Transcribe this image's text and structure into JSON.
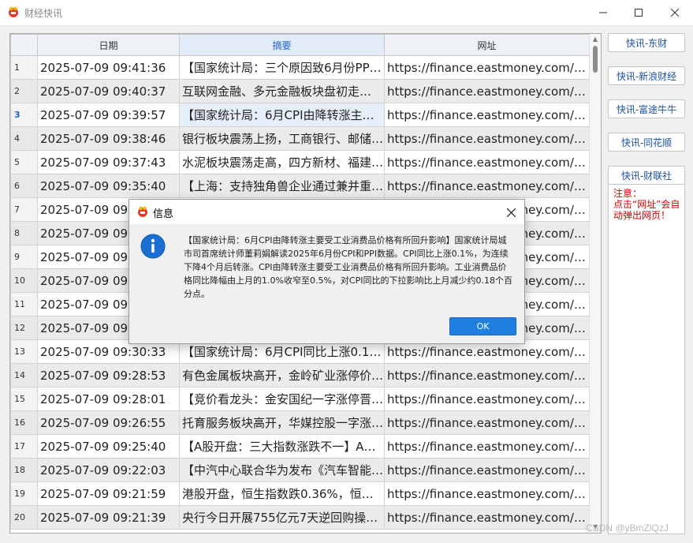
{
  "window": {
    "title": "财经快讯"
  },
  "grid": {
    "columns": [
      "日期",
      "摘要",
      "网址"
    ],
    "selected_row": 3,
    "rows": [
      {
        "n": "1",
        "date": "2025-07-09 09:41:36",
        "summary": "【国家统计局：三个原因致6月份PPI…",
        "url": "https://finance.eastmoney.com/a…"
      },
      {
        "n": "2",
        "date": "2025-07-09 09:40:37",
        "summary": "互联网金融、多元金融板块盘初走…",
        "url": "https://finance.eastmoney.com/a…"
      },
      {
        "n": "3",
        "date": "2025-07-09 09:39:57",
        "summary": "【国家统计局：6月CPI由降转涨主…",
        "url": "https://finance.eastmoney.com/a…"
      },
      {
        "n": "4",
        "date": "2025-07-09 09:38:46",
        "summary": "银行板块震荡上扬，工商银行、邮储…",
        "url": "https://finance.eastmoney.com/a…"
      },
      {
        "n": "5",
        "date": "2025-07-09 09:37:43",
        "summary": "水泥板块震荡走高，四方新材、福建…",
        "url": "https://finance.eastmoney.com/a…"
      },
      {
        "n": "6",
        "date": "2025-07-09 09:35:40",
        "summary": "【上海：支持独角兽企业通过兼并重…",
        "url": "https://finance.eastmoney.com/a…"
      },
      {
        "n": "7",
        "date": "2025-07-09 09:3",
        "summary": "",
        "url": "https://finance.eastmoney.com/a…"
      },
      {
        "n": "8",
        "date": "2025-07-09 09:3",
        "summary": "",
        "url": "https://finance.eastmoney.com/a…"
      },
      {
        "n": "9",
        "date": "2025-07-09 09:3",
        "summary": "",
        "url": "https://finance.eastmoney.com/a…"
      },
      {
        "n": "10",
        "date": "2025-07-09 09:3",
        "summary": "",
        "url": "https://finance.eastmoney.com/a…"
      },
      {
        "n": "11",
        "date": "2025-07-09 09:3",
        "summary": "",
        "url": "https://finance.eastmoney.com/a…"
      },
      {
        "n": "12",
        "date": "2025-07-09 09:3",
        "summary": "",
        "url": "https://finance.eastmoney.com/a…"
      },
      {
        "n": "13",
        "date": "2025-07-09 09:30:33",
        "summary": "【国家统计局：6月CPI同比上涨0.1…",
        "url": "https://finance.eastmoney.com/a…"
      },
      {
        "n": "14",
        "date": "2025-07-09 09:28:53",
        "summary": "有色金属板块高开，金岭矿业涨停价…",
        "url": "https://finance.eastmoney.com/a…"
      },
      {
        "n": "15",
        "date": "2025-07-09 09:28:01",
        "summary": "【竞价看龙头：金安国纪一字涨停晋…",
        "url": "https://finance.eastmoney.com/a…"
      },
      {
        "n": "16",
        "date": "2025-07-09 09:26:55",
        "summary": "托育服务板块高开，华媒控股一字涨…",
        "url": "https://finance.eastmoney.com/a…"
      },
      {
        "n": "17",
        "date": "2025-07-09 09:25:40",
        "summary": "【A股开盘：三大指数涨跌不一】A…",
        "url": "https://finance.eastmoney.com/a…"
      },
      {
        "n": "18",
        "date": "2025-07-09 09:22:03",
        "summary": "【中汽中心联合华为发布《汽车智能…",
        "url": "https://finance.eastmoney.com/a…"
      },
      {
        "n": "19",
        "date": "2025-07-09 09:21:59",
        "summary": "港股开盘，恒生指数跌0.36%，恒生…",
        "url": "https://finance.eastmoney.com/a…"
      },
      {
        "n": "20",
        "date": "2025-07-09 09:21:39",
        "summary": "央行今日开展755亿元7天逆回购操…",
        "url": "https://finance.eastmoney.com/a…"
      }
    ]
  },
  "side": {
    "buttons": [
      "快讯-东财",
      "快讯-新浪财经",
      "快讯-富途牛牛",
      "快讯-同花顺",
      "快讯-财联社"
    ],
    "notice": "注意：\n点击“网址”会自动弹出网页！"
  },
  "dialog": {
    "title": "信息",
    "message": "【国家统计局：6月CPI由降转涨主要受工业消费品价格有所回升影响】国家统计局城市司首席统计师董莉娟解读2025年6月份CPI和PPI数据。CPI同比上涨0.1%，为连续下降4个月后转涨。CPI由降转涨主要受工业消费品价格有所回升影响。工业消费品价格同比降幅由上月的1.0%收窄至0.5%，对CPI同比的下拉影响比上月减少约0.18个百分点。",
    "ok_label": "OK"
  },
  "watermark": "CSDN @yBmZlQzJ",
  "colors": {
    "accent": "#1e7fe0",
    "notice": "#d20000",
    "selected": "#1e63c9"
  },
  "icons": [
    "app-icon",
    "minimize-icon",
    "maximize-icon",
    "close-icon",
    "info-icon"
  ]
}
